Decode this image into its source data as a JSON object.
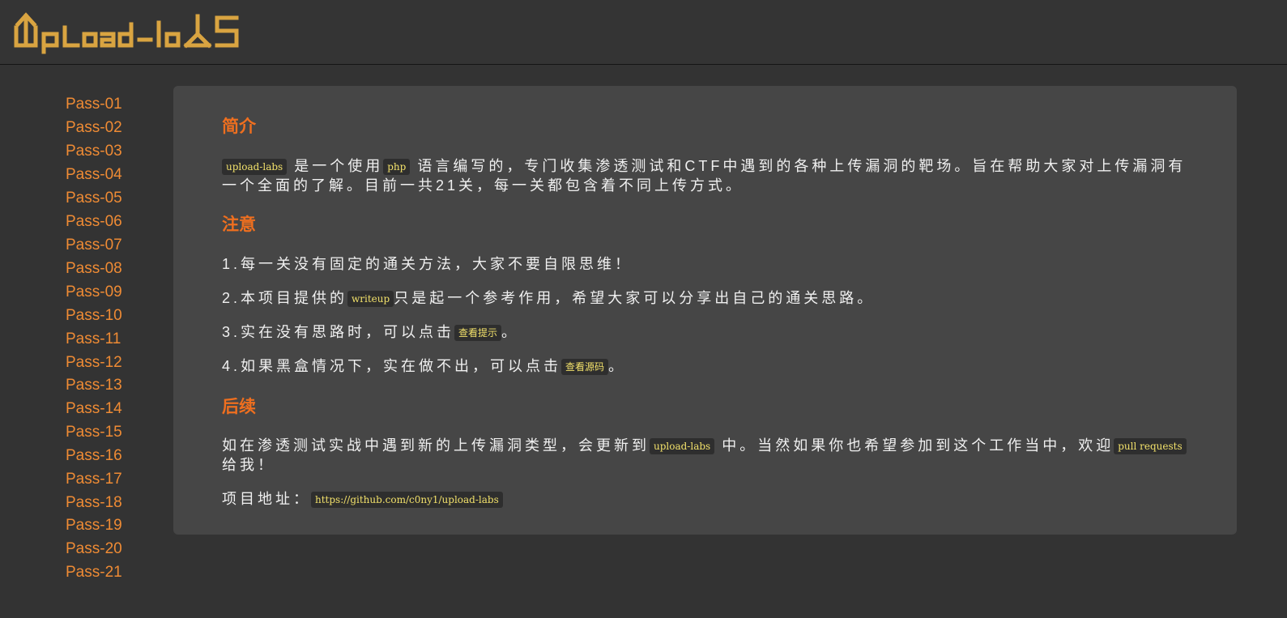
{
  "app": {
    "logo_text": "Upload-labs"
  },
  "sidebar": {
    "items": [
      "Pass-01",
      "Pass-02",
      "Pass-03",
      "Pass-04",
      "Pass-05",
      "Pass-06",
      "Pass-07",
      "Pass-08",
      "Pass-09",
      "Pass-10",
      "Pass-11",
      "Pass-12",
      "Pass-13",
      "Pass-14",
      "Pass-15",
      "Pass-16",
      "Pass-17",
      "Pass-18",
      "Pass-19",
      "Pass-20",
      "Pass-21"
    ]
  },
  "main": {
    "intro": {
      "heading": "简介",
      "code1": "upload-labs",
      "text1": "是一个使用",
      "code2": "php",
      "text2": "语言编写的，专门收集渗透测试和CTF中遇到的各种上传漏洞的靶场。旨在帮助大家对上传漏洞有一个全面的了解。目前一共21关，每一关都包含着不同上传方式。"
    },
    "notice": {
      "heading": "注意",
      "item1": "1.每一关没有固定的通关方法，大家不要自限思维！",
      "item2_pre": "2.本项目提供的",
      "item2_code": "writeup",
      "item2_post": "只是起一个参考作用，希望大家可以分享出自己的通关思路。",
      "item3_pre": "3.实在没有思路时，可以点击",
      "item3_button": "查看提示",
      "item3_post": "。",
      "item4_pre": "4.如果黑盒情况下，实在做不出，可以点击",
      "item4_button": "查看源码",
      "item4_post": "。"
    },
    "followup": {
      "heading": "后续",
      "text1": "如在渗透测试实战中遇到新的上传漏洞类型，会更新到",
      "code1": "upload-labs",
      "text2": "中。当然如果你也希望参加到这个工作当中，欢迎",
      "code2": "pull requests",
      "text3": "给我！",
      "project_label": "项目地址：",
      "project_url": "https://github.com/c0ny1/upload-labs"
    }
  },
  "colors": {
    "background": "#333333",
    "panel": "#464646",
    "accent": "#ef8b34",
    "heading": "#ef6f1f",
    "code_text": "#f1e06a",
    "logo": "#d9a441"
  }
}
